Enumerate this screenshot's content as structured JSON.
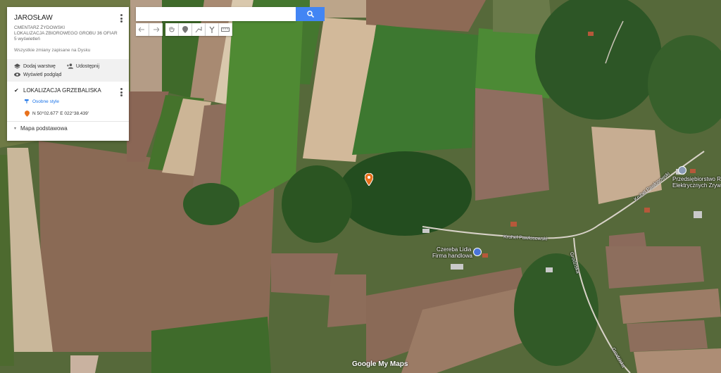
{
  "panel": {
    "title": "JAROSŁAW",
    "subtitle1": "CMENTARZ ŻYDOWSKI",
    "subtitle2": "LOKALIZACJA ZBIOROWEGO GROBU 36 OFIAR",
    "views": "5 wyświetleń",
    "saved": "Wszystkie zmiany zapisane na Dysku",
    "add_layer": "Dodaj warstwę",
    "share": "Udostępnij",
    "preview": "Wyświetl podgląd",
    "layer_name": "LOKALIZACJA GRZEBALISKA",
    "layer_styles": "Osobne style",
    "coordinates": "N 50°02.677' E 022°38.439'",
    "base_map": "Mapa podstawowa"
  },
  "search": {
    "placeholder": ""
  },
  "toolbar": [
    "undo-icon",
    "redo-icon",
    "hand-icon",
    "marker-icon",
    "line-icon",
    "directions-icon",
    "ruler-icon"
  ],
  "map_labels": {
    "road1": "Kruhel Pawłosowski",
    "road2": "Grodziska",
    "road3": "Kruhel Pawłosowski",
    "shop_line1": "Czereba Lidia",
    "shop_line2": "Firma handlowa",
    "company_line1": "Przedsiębiorstwo R",
    "company_line2": "Elektrycznych Zryw",
    "road4": "Grodziska"
  },
  "brand": "Google My Maps",
  "colors": {
    "accent": "#4285f4",
    "marker": "#e8711c",
    "link": "#1a73e8"
  }
}
